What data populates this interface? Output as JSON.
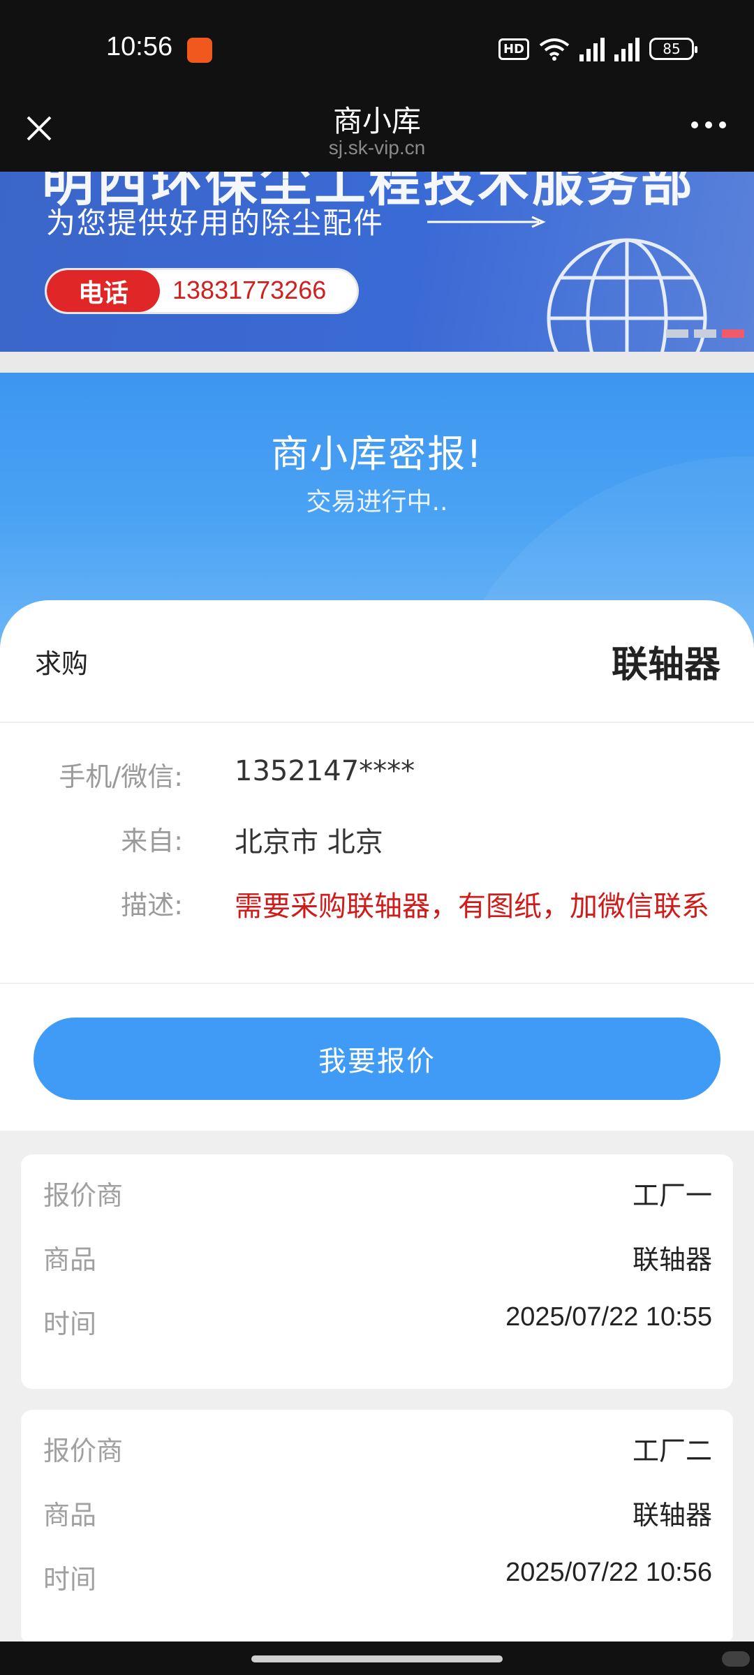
{
  "status_bar": {
    "time": "10:56",
    "hd_label": "HD",
    "signal_1": "4G",
    "signal_2": "4G",
    "battery": "85"
  },
  "title_bar": {
    "title": "商小库",
    "url": "sj.sk-vip.cn"
  },
  "banner": {
    "headline": "明西环保尘工程技术服务部",
    "subtitle": "为您提供好用的除尘配件",
    "phone_label": "电话",
    "phone_number": "13831773266",
    "active_slide": 3,
    "slide_count": 3
  },
  "hero": {
    "title": "商小库密报!",
    "subtitle": "交易进行中.."
  },
  "request": {
    "type_label": "求购",
    "product": "联轴器",
    "fields": [
      {
        "label": "手机/微信:",
        "value": "1352147****",
        "highlight": false
      },
      {
        "label": "来自:",
        "value": "北京市 北京",
        "highlight": false
      },
      {
        "label": "描述:",
        "value": "需要采购联轴器，有图纸，加微信联系",
        "highlight": true
      }
    ],
    "quote_button": "我要报价"
  },
  "quotes": [
    {
      "rows": [
        {
          "label": "报价商",
          "value": "工厂一"
        },
        {
          "label": "商品",
          "value": "联轴器"
        },
        {
          "label": "时间",
          "value": "2025/07/22 10:55"
        }
      ]
    },
    {
      "rows": [
        {
          "label": "报价商",
          "value": "工厂二"
        },
        {
          "label": "商品",
          "value": "联轴器"
        },
        {
          "label": "时间",
          "value": "2025/07/22 10:56"
        }
      ]
    }
  ],
  "colors": {
    "accent": "#3f9bf5",
    "highlight_text": "#d11a1a",
    "banner_blue": "#3a6ad6",
    "phone_red": "#e02626"
  }
}
